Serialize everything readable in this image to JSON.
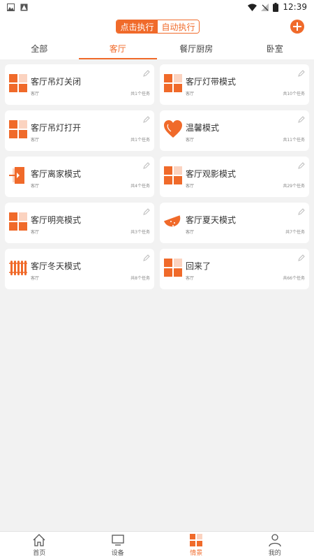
{
  "status_bar": {
    "time": "12:39"
  },
  "header": {
    "mode_tabs": [
      {
        "label": "点击执行",
        "active": true
      },
      {
        "label": "自动执行",
        "active": false
      }
    ],
    "add_icon": "plus-circle-icon"
  },
  "room_tabs": [
    {
      "label": "全部",
      "active": false
    },
    {
      "label": "客厅",
      "active": true
    },
    {
      "label": "餐厅厨房",
      "active": false
    },
    {
      "label": "卧室",
      "active": false
    }
  ],
  "scenes": [
    {
      "title": "客厅吊灯关闭",
      "room": "客厅",
      "tasks": "共1个任务",
      "icon": "grid-icon"
    },
    {
      "title": "客厅灯带模式",
      "room": "客厅",
      "tasks": "共10个任务",
      "icon": "grid-icon"
    },
    {
      "title": "客厅吊灯打开",
      "room": "客厅",
      "tasks": "共1个任务",
      "icon": "grid-icon"
    },
    {
      "title": "温馨模式",
      "room": "客厅",
      "tasks": "共11个任务",
      "icon": "heart-icon"
    },
    {
      "title": "客厅离家模式",
      "room": "客厅",
      "tasks": "共4个任务",
      "icon": "door-exit-icon"
    },
    {
      "title": "客厅观影模式",
      "room": "客厅",
      "tasks": "共29个任务",
      "icon": "grid-icon"
    },
    {
      "title": "客厅明亮模式",
      "room": "客厅",
      "tasks": "共3个任务",
      "icon": "grid-icon"
    },
    {
      "title": "客厅夏天模式",
      "room": "客厅",
      "tasks": "共7个任务",
      "icon": "watermelon-icon"
    },
    {
      "title": "客厅冬天模式",
      "room": "客厅",
      "tasks": "共8个任务",
      "icon": "radiator-icon"
    },
    {
      "title": "回来了",
      "room": "客厅",
      "tasks": "共66个任务",
      "icon": "grid-icon"
    }
  ],
  "bottom_nav": [
    {
      "label": "首页",
      "icon": "home-icon",
      "active": false
    },
    {
      "label": "设备",
      "icon": "tv-icon",
      "active": false
    },
    {
      "label": "情景",
      "icon": "scene-grid-icon",
      "active": true
    },
    {
      "label": "我的",
      "icon": "user-icon",
      "active": false
    }
  ],
  "colors": {
    "accent": "#f06a2a",
    "background": "#f2f2f2"
  }
}
